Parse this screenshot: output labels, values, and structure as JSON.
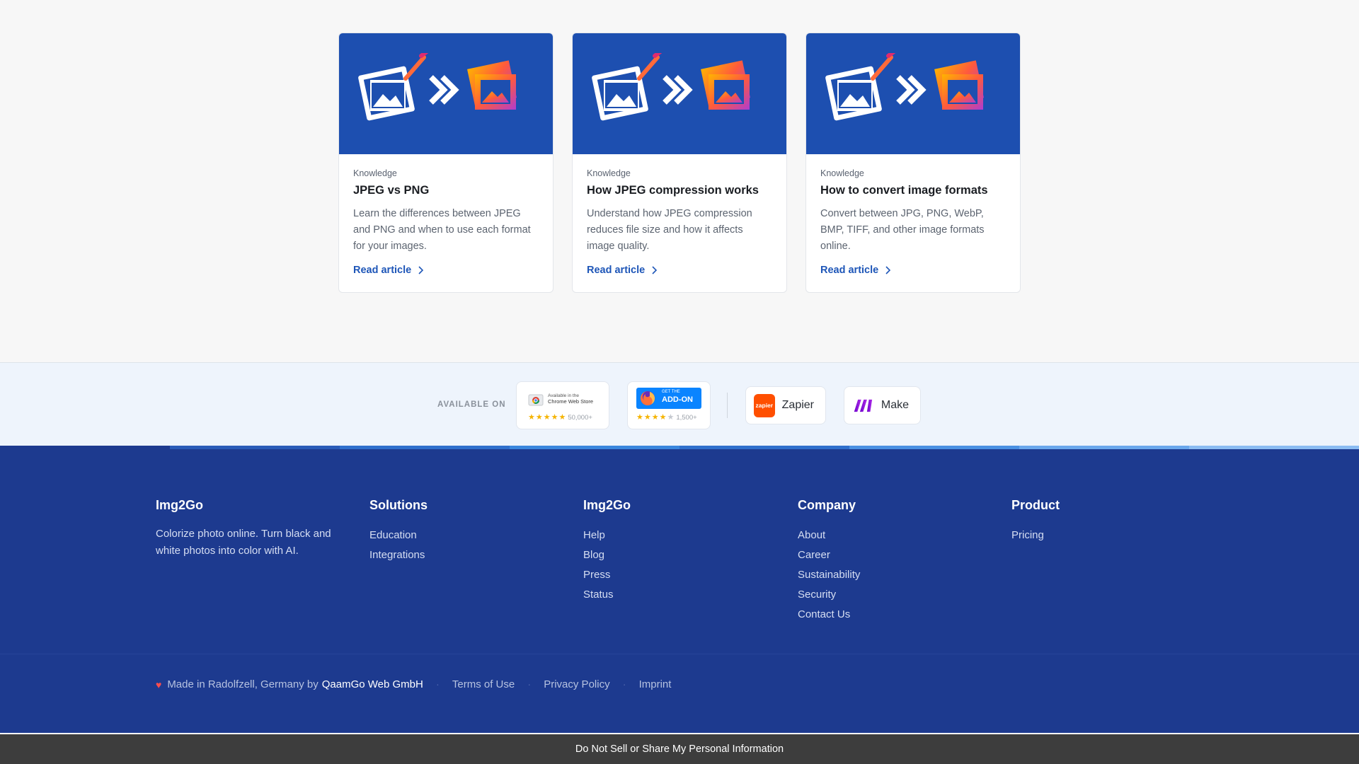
{
  "articles": [
    {
      "category": "Knowledge",
      "title": "JPEG vs PNG",
      "description": "Learn the differences between JPEG and PNG and when to use each format for your images.",
      "link": "Read article"
    },
    {
      "category": "Knowledge",
      "title": "How JPEG compression works",
      "description": "Understand how JPEG compression reduces file size and how it affects image quality.",
      "link": "Read article"
    },
    {
      "category": "Knowledge",
      "title": "How to convert image formats",
      "description": "Convert between JPG, PNG, WebP, BMP, TIFF, and other image formats online.",
      "link": "Read article"
    }
  ],
  "available": {
    "label": "AVAILABLE ON",
    "chrome": {
      "line1": "Available in the",
      "line2": "Chrome Web Store",
      "count": "50,000+"
    },
    "firefox": {
      "line1": "GET THE",
      "line2": "ADD-ON",
      "count": "1,500+"
    },
    "zapier": {
      "logo": "zapier",
      "label": "Zapier"
    },
    "make": {
      "label": "Make"
    }
  },
  "footer": {
    "stripe_colors": [
      "#1d3a8f",
      "#2a5bb8",
      "#2f6fcc",
      "#3a86dd",
      "#2f6fcc",
      "#4a90e2",
      "#6aa7ec",
      "#8bbcf2"
    ],
    "brand": {
      "title": "Img2Go",
      "tagline": "Colorize photo online. Turn black and white photos into color with AI."
    },
    "columns": [
      {
        "title": "Solutions",
        "items": [
          "Education",
          "Integrations"
        ]
      },
      {
        "title": "Img2Go",
        "items": [
          "Help",
          "Blog",
          "Press",
          "Status"
        ]
      },
      {
        "title": "Company",
        "items": [
          "About",
          "Career",
          "Sustainability",
          "Security",
          "Contact Us"
        ]
      },
      {
        "title": "Product",
        "items": [
          "Pricing"
        ]
      }
    ],
    "legal": {
      "made_in": "Made in Radolfzell, Germany by",
      "company": "QaamGo Web GmbH",
      "terms": "Terms of Use",
      "privacy": "Privacy Policy",
      "imprint": "Imprint"
    }
  },
  "do_not_sell": "Do Not Sell or Share My Personal Information",
  "colors": {
    "thumb_bg": "#1d4fb0",
    "link": "#1e56b8",
    "footer_bg": "#1d3a8f"
  }
}
